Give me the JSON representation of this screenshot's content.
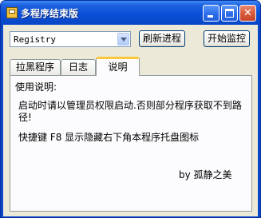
{
  "window": {
    "title": "多程序结束版"
  },
  "toolbar": {
    "process_combo_value": "Registry",
    "refresh_label": "刷新进程",
    "start_monitor_label": "开始监控"
  },
  "tabs": [
    {
      "label": "拉黑程序"
    },
    {
      "label": "日志"
    },
    {
      "label": "说明"
    }
  ],
  "description": {
    "heading": "使用说明:",
    "note": "启动时请以管理员权限启动.否则部分程序获取不到路径!",
    "hotkey": "快捷键  F8  显示隐藏右下角本程序托盘图标",
    "author": "by  孤静之美"
  },
  "icons": {
    "app": "app-icon",
    "minimize": "minimize-icon",
    "maximize": "maximize-icon",
    "close": "close-icon",
    "dropdown": "chevron-down-icon"
  }
}
